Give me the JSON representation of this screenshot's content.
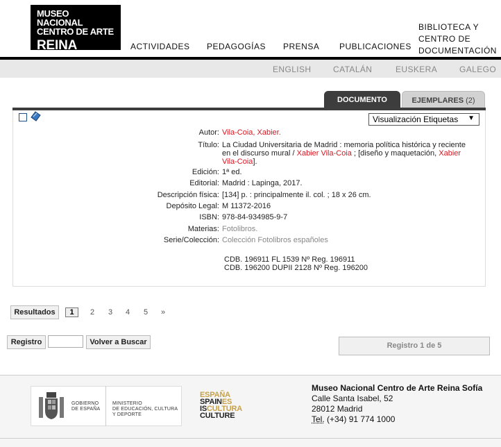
{
  "header": {
    "logo": [
      "MUSEO NACIONAL",
      "CENTRO DE ARTE",
      "REINA SOFIA"
    ],
    "nav": [
      "ACTIVIDADES",
      "PEDAGOGÍAS",
      "PRENSA",
      "PUBLICACIONES"
    ],
    "nav_bib": [
      "BIBLIOTECA Y",
      "CENTRO DE",
      "DOCUMENTACIÓN"
    ],
    "languages": [
      "ENGLISH",
      "CATALÁN",
      "EUSKERA",
      "GALEGO"
    ]
  },
  "tabs": {
    "documento": "DOCUMENTO",
    "ejemplares": "EJEMPLARES",
    "ejemplares_count": "(2)"
  },
  "view_select": {
    "value": "Visualización Etiquetas",
    "arrow": "▼"
  },
  "record": {
    "autor_label": "Autor:",
    "autor": "Vila-Coia, Xabier.",
    "titulo_label": "Título:",
    "titulo_1": "La Ciudad Universitaria de Madrid : memoria política histórica y reciente en el discurso mural / ",
    "titulo_link1": "Xabier Vila-Coia",
    "titulo_2": " ; [diseño y maquetación, ",
    "titulo_link2": "Xabier Vila-Coia",
    "titulo_3": "].",
    "edicion_label": "Edición:",
    "edicion": "1ª ed.",
    "editorial_label": "Editorial:",
    "editorial": "Madrid : Lapinga, 2017.",
    "descripcion_label": "Descripción física:",
    "descripcion": "[134] p. : principalmente il. col. ; 18 x 26 cm.",
    "deposito_label": "Depósito Legal:",
    "deposito": "M 11372-2016",
    "isbn_label": "ISBN:",
    "isbn": "978-84-934985-9-7",
    "materias_label": "Materias:",
    "materias": "Fotolibros.",
    "serie_label": "Serie/Colección:",
    "serie": "Colección Fotolibros españoles",
    "copies": [
      "CDB. 196911 FL 1539 Nº Reg. 196911",
      "CDB. 196200 DUPII 2128 Nº Reg. 196200"
    ]
  },
  "pagination": {
    "resultados": "Resultados",
    "pages": [
      "1",
      "2",
      "3",
      "4",
      "5"
    ],
    "next": "»"
  },
  "nav_controls": {
    "registro": "Registro",
    "volver": "Volver a Buscar",
    "registro_status": "Registro 1 de 5"
  },
  "footer": {
    "gobierno": [
      "GOBIERNO",
      "DE ESPAÑA"
    ],
    "ministerio": [
      "MINISTERIO",
      "DE EDUCACIÓN, CULTURA",
      "Y DEPORTE"
    ],
    "espana": [
      "ESPAÑA",
      "SPAIN",
      "ES",
      "IS",
      "CULTURA",
      "CULTURE"
    ],
    "address_title": "Museo Nacional Centro de Arte Reina Sofía",
    "address_lines": [
      "Calle Santa Isabel, 52",
      "28012 Madrid"
    ],
    "tel_label": "Tel.",
    "tel": "(+34) 91 774 1000"
  },
  "colors": {
    "link_red": "#d7141f",
    "tab_dark": "#3d3d3d",
    "muted": "#888888"
  }
}
